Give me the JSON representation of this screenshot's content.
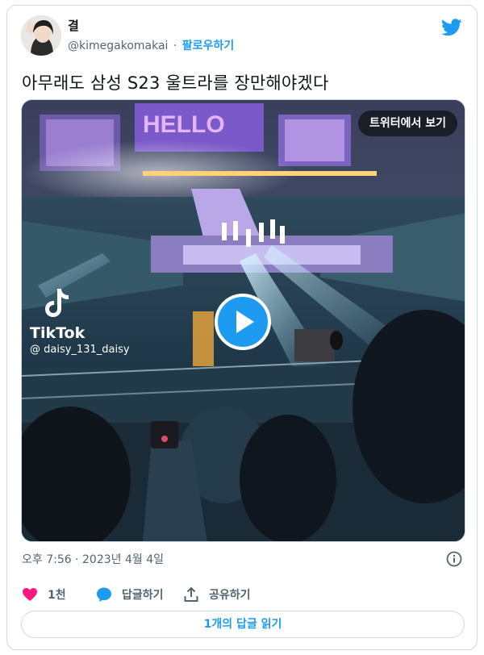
{
  "author": {
    "display_name": "결",
    "handle": "@kimegakomakai",
    "separator": "·",
    "follow_label": "팔로우하기"
  },
  "tweet": {
    "text": "아무래도 삼성 S23 울트라를 장만해야겠다",
    "timestamp": "오후 7:56 · 2023년 4월 4일"
  },
  "media": {
    "view_on_twitter_label": "트위터에서 보기",
    "stage_screen_text": "HELLO",
    "watermark": {
      "brand": "TikTok",
      "username": "@ daisy_131_daisy"
    }
  },
  "actions": {
    "like_count": "1천",
    "reply_label": "답글하기",
    "share_label": "공유하기"
  },
  "read_replies_label": "1개의 답글 읽기",
  "colors": {
    "accent": "#1d9bf0",
    "like": "#f91880",
    "muted_text": "#536471",
    "border": "#cfd9de"
  },
  "icons": [
    "twitter-bird-icon",
    "play-icon",
    "tiktok-logo-icon",
    "info-icon",
    "heart-icon",
    "reply-bubble-icon",
    "share-icon"
  ]
}
